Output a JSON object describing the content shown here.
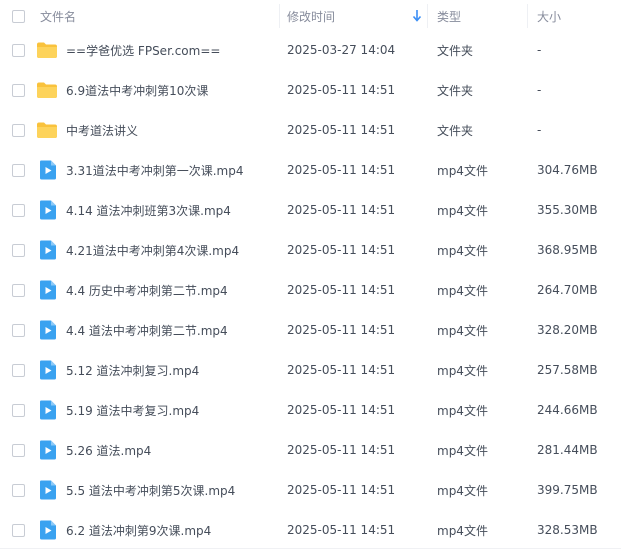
{
  "header": {
    "name": "文件名",
    "time": "修改时间",
    "type": "类型",
    "size": "大小"
  },
  "colors": {
    "folder": "#f9c23c",
    "video": "#3aa2f0",
    "text": "#454d5a",
    "header_text": "#878c9c",
    "sort_arrow": "#3b8ef5"
  },
  "files": [
    {
      "icon": "folder-icon",
      "name": "==学爸优选 FPSer.com==",
      "time": "2025-03-27 14:04",
      "type": "文件夹",
      "size": "-"
    },
    {
      "icon": "folder-icon",
      "name": "6.9道法中考冲刺第10次课",
      "time": "2025-05-11 14:51",
      "type": "文件夹",
      "size": "-"
    },
    {
      "icon": "folder-icon",
      "name": "中考道法讲义",
      "time": "2025-05-11 14:51",
      "type": "文件夹",
      "size": "-"
    },
    {
      "icon": "video-icon",
      "name": "3.31道法中考冲刺第一次课.mp4",
      "time": "2025-05-11 14:51",
      "type": "mp4文件",
      "size": "304.76MB"
    },
    {
      "icon": "video-icon",
      "name": "4.14 道法冲刺班第3次课.mp4",
      "time": "2025-05-11 14:51",
      "type": "mp4文件",
      "size": "355.30MB"
    },
    {
      "icon": "video-icon",
      "name": "4.21道法中考冲刺第4次课.mp4",
      "time": "2025-05-11 14:51",
      "type": "mp4文件",
      "size": "368.95MB"
    },
    {
      "icon": "video-icon",
      "name": "4.4 历史中考冲刺第二节.mp4",
      "time": "2025-05-11 14:51",
      "type": "mp4文件",
      "size": "264.70MB"
    },
    {
      "icon": "video-icon",
      "name": "4.4 道法中考冲刺第二节.mp4",
      "time": "2025-05-11 14:51",
      "type": "mp4文件",
      "size": "328.20MB"
    },
    {
      "icon": "video-icon",
      "name": "5.12 道法冲刺复习.mp4",
      "time": "2025-05-11 14:51",
      "type": "mp4文件",
      "size": "257.58MB"
    },
    {
      "icon": "video-icon",
      "name": "5.19 道法中考复习.mp4",
      "time": "2025-05-11 14:51",
      "type": "mp4文件",
      "size": "244.66MB"
    },
    {
      "icon": "video-icon",
      "name": "5.26 道法.mp4",
      "time": "2025-05-11 14:51",
      "type": "mp4文件",
      "size": "281.44MB"
    },
    {
      "icon": "video-icon",
      "name": "5.5 道法中考冲刺第5次课.mp4",
      "time": "2025-05-11 14:51",
      "type": "mp4文件",
      "size": "399.75MB"
    },
    {
      "icon": "video-icon",
      "name": "6.2 道法冲刺第9次课.mp4",
      "time": "2025-05-11 14:51",
      "type": "mp4文件",
      "size": "328.53MB"
    }
  ]
}
